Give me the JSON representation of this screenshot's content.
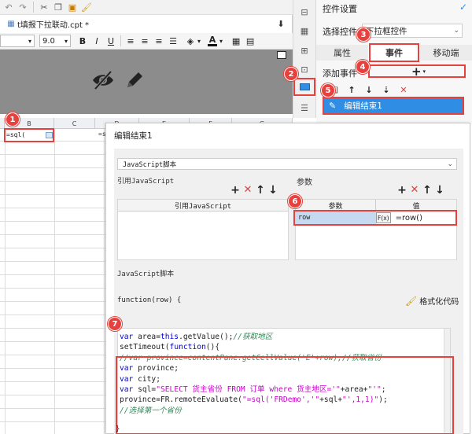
{
  "editor": {
    "file_tab": "t填报下拉联动.cpt *",
    "font_size": "9.0",
    "fmt_bold": "B",
    "fmt_italic": "I",
    "fmt_underline": "U",
    "fmt_fontcolor": "A",
    "columns": [
      "B",
      "C",
      "D",
      "E",
      "F",
      "G"
    ],
    "cell_b1": "=sql(",
    "cell_d1": "=s"
  },
  "right_panel": {
    "title": "控件设置",
    "select_label": "选择控件",
    "select_value": "下拉框控件",
    "tabs": [
      "属性",
      "事件",
      "移动端"
    ],
    "add_event_label": "添加事件",
    "add_symbol": "+",
    "event_item": "编辑结束1"
  },
  "dialog": {
    "title": "编辑结束1",
    "type_select": "JavaScript脚本",
    "ref_js_title": "引用JavaScript",
    "ref_js_col": "引用JavaScript",
    "params_title": "参数",
    "params_cols": [
      "参数",
      "值"
    ],
    "param_row": {
      "name": "row",
      "fx": "F(x)",
      "value": "=row()"
    },
    "script_title": "JavaScript脚本",
    "function_sig": "function(row) {",
    "format_btn": "格式化代码",
    "close_brace": "}",
    "code_lines": [
      "var area=this.getValue();//获取地区",
      "setTimeout(function(){",
      "//var province=contentPane.getCellValue('E'+row);//获取省份",
      "var province;",
      "var city;",
      "var sql=\"SELECT 货主省份 FROM 订单 where 货主地区='\"+area+\"'\";",
      "province=FR.remoteEvaluate(\"=sql('FRDemo','\"+sql+\"',1,1)\");",
      "//选择第一个省份"
    ]
  },
  "badges": [
    "1",
    "2",
    "3",
    "4",
    "5",
    "6",
    "7"
  ],
  "colors": {
    "accent": "#1e7fd9",
    "badge": "#e8403c",
    "selected_row": "#2f8de4"
  }
}
